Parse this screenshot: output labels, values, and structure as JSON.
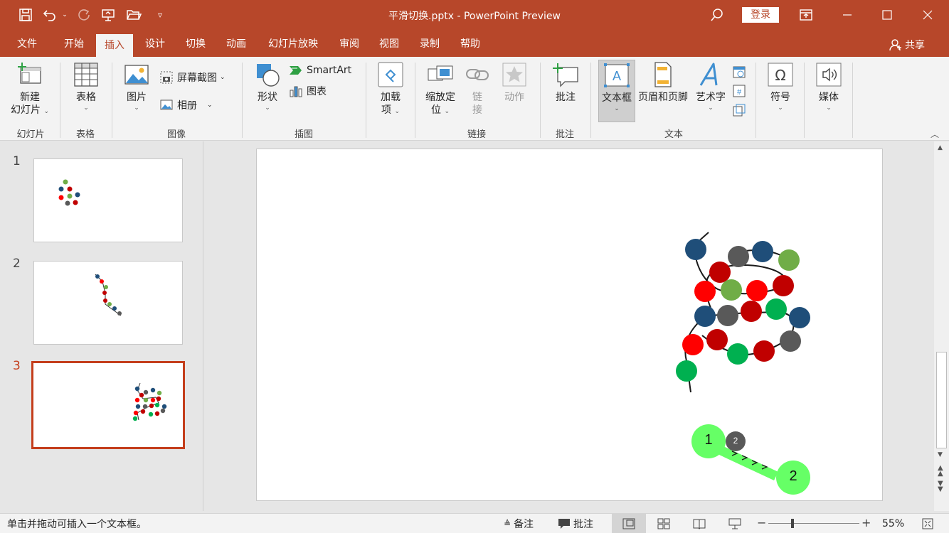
{
  "titlebar": {
    "title": "平滑切换.pptx  -  PowerPoint Preview",
    "login": "登录",
    "accent": "#b7472a"
  },
  "tabs": [
    {
      "label": "文件"
    },
    {
      "label": "开始"
    },
    {
      "label": "插入",
      "active": true
    },
    {
      "label": "设计"
    },
    {
      "label": "切换"
    },
    {
      "label": "动画"
    },
    {
      "label": "幻灯片放映"
    },
    {
      "label": "审阅"
    },
    {
      "label": "视图"
    },
    {
      "label": "录制"
    },
    {
      "label": "帮助"
    }
  ],
  "share": "共享",
  "ribbon": {
    "groups": {
      "slides": "幻灯片",
      "tables": "表格",
      "images": "图像",
      "illustrations": "插图",
      "links": "链接",
      "comments": "批注",
      "text": "文本"
    },
    "new_slide": {
      "line1": "新建",
      "line2": "幻灯片"
    },
    "table": "表格",
    "pictures": "图片",
    "screenshot": "屏幕截图",
    "album": "相册",
    "shapes": "形状",
    "smartart": "SmartArt",
    "chart": "图表",
    "addins": {
      "line1": "加载",
      "line2": "项"
    },
    "zoom": {
      "line1": "缩放定",
      "line2": "位"
    },
    "link": {
      "line1": "链",
      "line2": "接"
    },
    "action": "动作",
    "comment": "批注",
    "textbox": "文本框",
    "header_footer": "页眉和页脚",
    "wordart": "艺术字",
    "symbol": "符号",
    "media": "媒体"
  },
  "thumbnails": [
    {
      "num": "1"
    },
    {
      "num": "2"
    },
    {
      "num": "3",
      "selected": true
    }
  ],
  "slide": {
    "label_1": "1",
    "label_2": "2",
    "label_small": "2"
  },
  "status": {
    "hint": "单击并拖动可插入一个文本框。",
    "notes": "备注",
    "comments": "批注",
    "zoom": "55%"
  },
  "colors": {
    "navy": "#1f4e79",
    "gray": "#595959",
    "red": "#ff0000",
    "darkred": "#c00000",
    "olive": "#70ad47",
    "green": "#00b050",
    "lime": "#66ff66"
  }
}
